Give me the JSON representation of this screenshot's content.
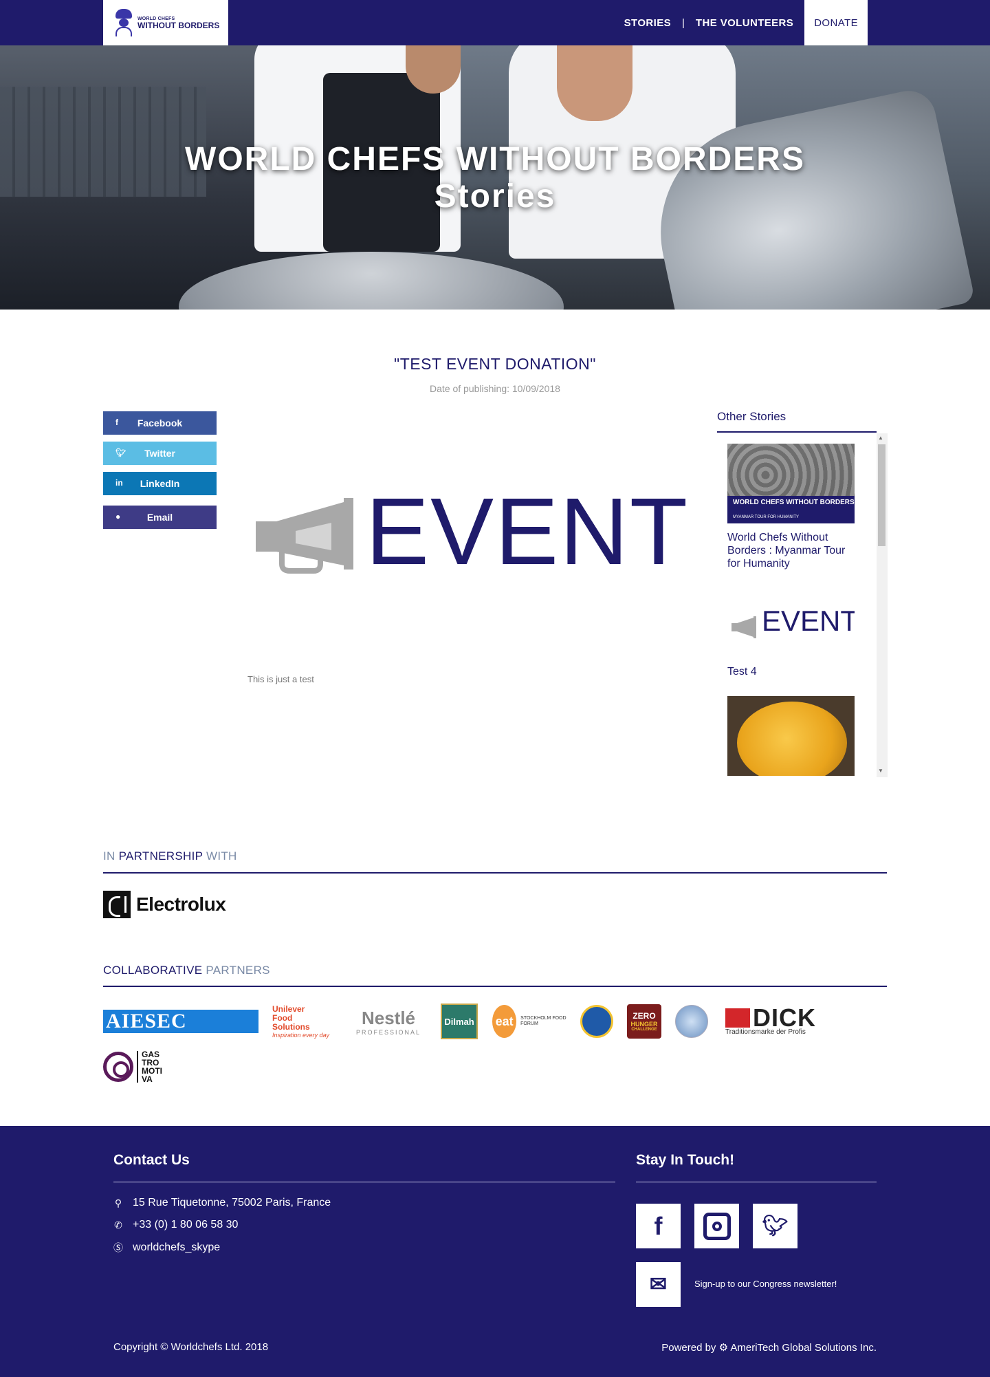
{
  "nav": {
    "logo_line1": "WORLD CHEFS",
    "logo_line2": "WITHOUT BORDERS",
    "stories": "STORIES",
    "separator": "|",
    "volunteers": "THE VOLUNTEERS",
    "donate": "DONATE"
  },
  "hero": {
    "title": "WORLD CHEFS WITHOUT BORDERS",
    "subtitle": "Stories"
  },
  "article": {
    "title": "\"TEST EVENT DONATION\"",
    "date_label": "Date of publishing: 10/09/2018",
    "image_text": "EVENT",
    "body": "This is just a test"
  },
  "share": {
    "facebook": "Facebook",
    "twitter": "Twitter",
    "linkedin": "LinkedIn",
    "email": "Email"
  },
  "other_stories": {
    "heading": "Other Stories",
    "items": [
      {
        "title": "World Chefs Without Borders : Myanmar Tour for Humanity",
        "image_caption": "WORLD CHEFS WITHOUT BORDERS",
        "image_sub": "MYANMAR TOUR FOR HUMANITY"
      },
      {
        "title": "Test 4",
        "image_text": "EVENT"
      },
      {
        "title": ""
      }
    ]
  },
  "partnership": {
    "title_pre": "IN ",
    "title_strong": "PARTNERSHIP",
    "title_post": " WITH",
    "partner": "Electrolux"
  },
  "collaborative": {
    "title_strong": "COLLABORATIVE",
    "title_post": " PARTNERS",
    "logos": {
      "aiesec": "AIESEC",
      "unilever_1": "Unilever",
      "unilever_2": "Food",
      "unilever_3": "Solutions",
      "unilever_tag": "Inspiration every day",
      "nestle": "Nestlé",
      "nestle_sub": "PROFESSIONAL",
      "dilmah": "Dilmah",
      "eat": "eat",
      "eat_sub": "STOCKHOLM FOOD FORUM",
      "zero_1": "ZERO",
      "zero_2": "HUNGER",
      "zero_3": "CHALLENGE",
      "dick": "DICK",
      "dick_sub": "Traditionsmarke der Profis",
      "gastro": "GAS TRO MOTI VA"
    }
  },
  "footer": {
    "contact_heading": "Contact Us",
    "address": "15 Rue Tiquetonne, 75002 Paris, France",
    "phone": "+33 (0) 1 80 06 58 30",
    "skype": "worldchefs_skype",
    "stay_heading": "Stay In Touch!",
    "newsletter": "Sign-up to our Congress newsletter!",
    "copyright": "Copyright © Worldchefs Ltd. 2018",
    "powered": "Powered by ⚙ AmeriTech Global Solutions Inc."
  },
  "colors": {
    "brand_navy": "#1f1b6b",
    "facebook": "#3b579d",
    "twitter": "#5bbde4",
    "linkedin": "#0c77b5",
    "email": "#3e3b86"
  },
  "icons": {
    "location": "map-pin-icon",
    "phone": "phone-icon",
    "skype": "skype-icon",
    "facebook": "facebook-icon",
    "instagram": "instagram-icon",
    "twitter": "twitter-icon",
    "newsletter": "envelope-at-icon",
    "megaphone": "megaphone-icon"
  }
}
